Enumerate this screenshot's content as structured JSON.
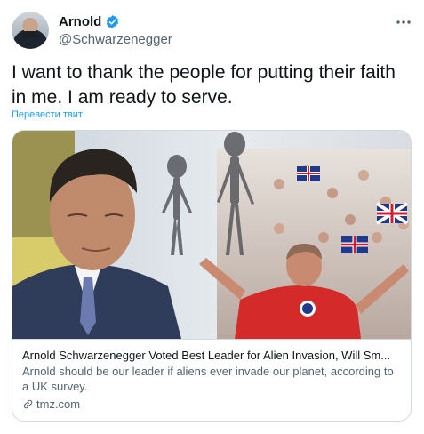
{
  "author": {
    "display_name": "Arnold",
    "handle": "@Schwarzenegger"
  },
  "tweet": {
    "text": "I want to thank the people for putting their faith in me. I am ready to serve.",
    "translate_label": "Перевести твит"
  },
  "card": {
    "title": "Arnold Schwarzenegger Voted Best Leader for Alien Invasion, Will Sm...",
    "description": "Arnold should be our leader if aliens ever invade our planet, according to a UK survey.",
    "domain": "tmz.com"
  },
  "colors": {
    "accent": "#1d9bf0",
    "text_primary": "#0f1419",
    "text_secondary": "#536471",
    "border": "#cfd9de"
  },
  "icons": {
    "verified": "verified-badge-icon",
    "more": "more-horizontal-icon",
    "link": "link-icon"
  }
}
